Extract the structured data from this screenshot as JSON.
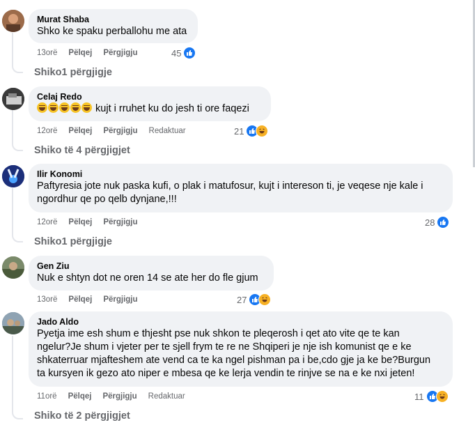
{
  "comments": [
    {
      "author": "Murat Shaba",
      "lines": [
        "Shko ke spaku perballohu me ata"
      ],
      "time": "13orë",
      "like": "Pëlqej",
      "reply": "Përgjigju",
      "edited": "",
      "count": "45",
      "reacts": [
        "like"
      ],
      "view_replies": "Shiko1 përgjigje"
    },
    {
      "author": "Celaj Redo",
      "lines": [
        "kujt i rruhet ku do jesh ti ore faqezi"
      ],
      "emoji_prefix": 5,
      "time": "12orë",
      "like": "Pëlqej",
      "reply": "Përgjigju",
      "edited": "Redaktuar",
      "count": "21",
      "reacts": [
        "like",
        "haha"
      ],
      "view_replies": "Shiko të 4 përgjigjet"
    },
    {
      "author": "Ilir Konomi",
      "lines": [
        "Paftyresia jote nuk paska kufi, o plak i matufosur, kujt i intereson ti, je veqese nje kale i",
        "ngordhur qe po qelb dynjane,!!!"
      ],
      "time": "12orë",
      "like": "Pëlqej",
      "reply": "Përgjigju",
      "edited": "",
      "count": "28",
      "reacts": [
        "like"
      ],
      "view_replies": "Shiko1 përgjigje"
    },
    {
      "author": "Gen Ziu",
      "lines": [
        "Nuk e shtyn dot ne oren 14 se ate her do fle gjum"
      ],
      "time": "13orë",
      "like": "Pëlqej",
      "reply": "Përgjigju",
      "edited": "",
      "count": "27",
      "reacts": [
        "like",
        "haha"
      ],
      "view_replies": ""
    },
    {
      "author": "Jado Aldo",
      "lines": [
        "Pyetja ime esh shum e thjesht pse nuk shkon te pleqerosh i qet ato vite qe te kan",
        "ngelur?Je shum i vjeter per te sjell frym te re ne Shqiperi je nje ish komunist qe e ke",
        "shkaterruar mjafteshem ate vend ca te ka ngel pishman pa i be,cdo gje ja ke be?Burgun",
        "ta kursyen ik gezo ato niper e mbesa qe ke lerja vendin te rinjve se na e ke nxi jeten!"
      ],
      "time": "11orë",
      "like": "Pëlqej",
      "reply": "Përgjigju",
      "edited": "Redaktuar",
      "count": "11",
      "reacts": [
        "like",
        "haha"
      ],
      "view_replies": "Shiko të 2 përgjigjet"
    }
  ],
  "colors": {
    "bubble": "#f0f2f5",
    "meta": "#65676b",
    "like": "#1877f2",
    "haha": "#f7b125"
  },
  "icons": {
    "like": "thumbs-up-icon",
    "haha": "laughing-face-icon"
  }
}
